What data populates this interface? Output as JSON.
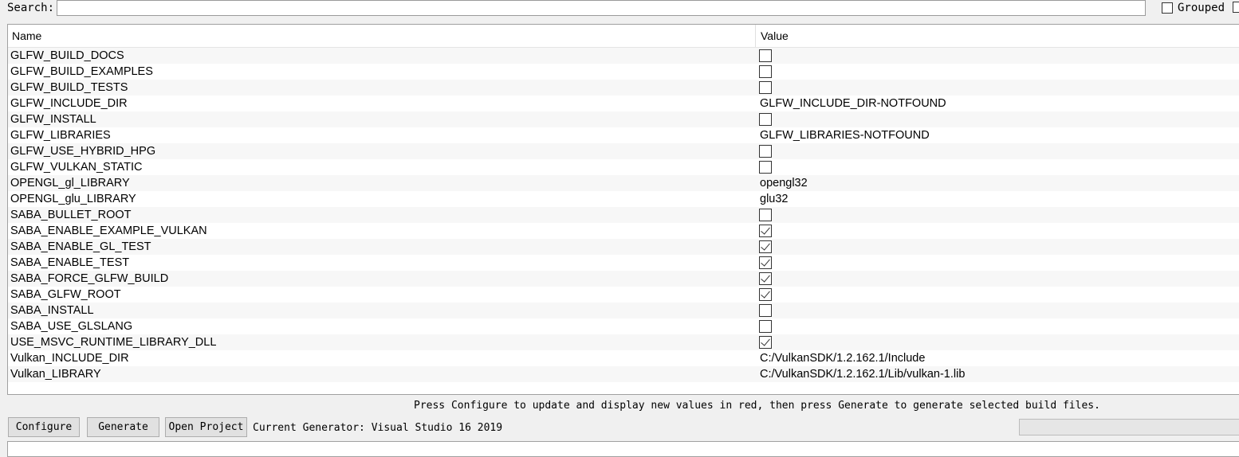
{
  "search": {
    "label": "Search:",
    "value": ""
  },
  "grouped": {
    "label": "Grouped",
    "checked": false
  },
  "table": {
    "headers": {
      "name": "Name",
      "value": "Value"
    },
    "rows": [
      {
        "name": "GLFW_BUILD_DOCS",
        "type": "bool",
        "checked": false
      },
      {
        "name": "GLFW_BUILD_EXAMPLES",
        "type": "bool",
        "checked": false
      },
      {
        "name": "GLFW_BUILD_TESTS",
        "type": "bool",
        "checked": false
      },
      {
        "name": "GLFW_INCLUDE_DIR",
        "type": "text",
        "value": "GLFW_INCLUDE_DIR-NOTFOUND"
      },
      {
        "name": "GLFW_INSTALL",
        "type": "bool",
        "checked": false
      },
      {
        "name": "GLFW_LIBRARIES",
        "type": "text",
        "value": "GLFW_LIBRARIES-NOTFOUND"
      },
      {
        "name": "GLFW_USE_HYBRID_HPG",
        "type": "bool",
        "checked": false
      },
      {
        "name": "GLFW_VULKAN_STATIC",
        "type": "bool",
        "checked": false
      },
      {
        "name": "OPENGL_gl_LIBRARY",
        "type": "text",
        "value": "opengl32"
      },
      {
        "name": "OPENGL_glu_LIBRARY",
        "type": "text",
        "value": "glu32"
      },
      {
        "name": "SABA_BULLET_ROOT",
        "type": "bool",
        "checked": false
      },
      {
        "name": "SABA_ENABLE_EXAMPLE_VULKAN",
        "type": "bool",
        "checked": true
      },
      {
        "name": "SABA_ENABLE_GL_TEST",
        "type": "bool",
        "checked": true
      },
      {
        "name": "SABA_ENABLE_TEST",
        "type": "bool",
        "checked": true
      },
      {
        "name": "SABA_FORCE_GLFW_BUILD",
        "type": "bool",
        "checked": true
      },
      {
        "name": "SABA_GLFW_ROOT",
        "type": "bool",
        "checked": true
      },
      {
        "name": "SABA_INSTALL",
        "type": "bool",
        "checked": false
      },
      {
        "name": "SABA_USE_GLSLANG",
        "type": "bool",
        "checked": false
      },
      {
        "name": "USE_MSVC_RUNTIME_LIBRARY_DLL",
        "type": "bool",
        "checked": true
      },
      {
        "name": "Vulkan_INCLUDE_DIR",
        "type": "text",
        "value": "C:/VulkanSDK/1.2.162.1/Include"
      },
      {
        "name": "Vulkan_LIBRARY",
        "type": "text",
        "value": "C:/VulkanSDK/1.2.162.1/Lib/vulkan-1.lib"
      }
    ]
  },
  "message": "Press Configure to update and display new values in red, then press Generate to generate selected build files.",
  "buttons": {
    "configure": "Configure",
    "generate": "Generate",
    "open_project": "Open Project"
  },
  "generator": "Current Generator: Visual Studio 16 2019"
}
